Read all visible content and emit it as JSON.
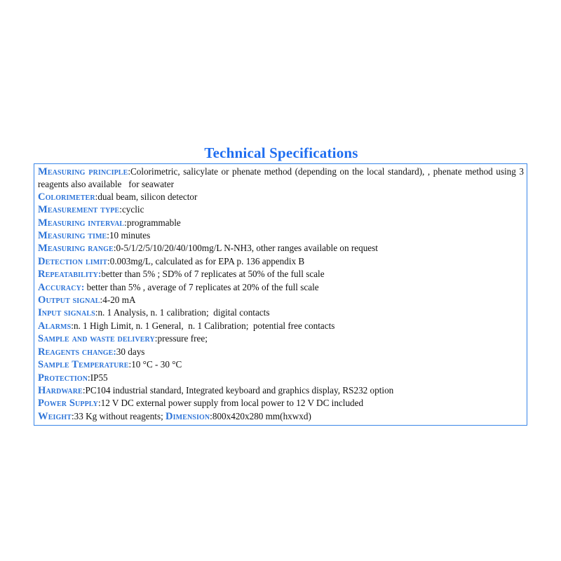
{
  "document": {
    "title": "Technical Specifications",
    "title_color": "#1f6ef0",
    "label_color": "#2d74d8",
    "body_color": "#111111",
    "border_color": "#3a86e8"
  },
  "specs": [
    {
      "label": "Measuring principle",
      "separator": ":",
      "value": "Colorimetric, salicylate or phenate method (depending on the local standard), , phenate method using 3 reagents also available   for seawater",
      "justified": true,
      "colon_colored": false
    },
    {
      "label": "Colorimeter",
      "separator": ":",
      "value": "dual beam, silicon detector",
      "justified": false,
      "colon_colored": false
    },
    {
      "label": "Measurement type",
      "separator": ":",
      "value": "cyclic",
      "justified": false,
      "colon_colored": false
    },
    {
      "label": "Measuring interval",
      "separator": ":",
      "value": "programmable",
      "justified": false,
      "colon_colored": false
    },
    {
      "label": "Measuring time",
      "separator": ":",
      "value": "10 minutes",
      "justified": false,
      "colon_colored": false
    },
    {
      "label": "Measuring range",
      "separator": ":",
      "value": "0-5/1/2/5/10/20/40/100mg/L N-NH3, other ranges available on request",
      "justified": false,
      "colon_colored": false
    },
    {
      "label": "Detection limit",
      "separator": ":",
      "value": "0.003mg/L, calculated as for EPA p. 136 appendix B",
      "justified": false,
      "colon_colored": false
    },
    {
      "label": "Repeatability",
      "separator": ":",
      "value": "better than 5% ; SD% of 7 replicates at 50% of the full scale",
      "justified": false,
      "colon_colored": true
    },
    {
      "label": "Accuracy",
      "separator": ":",
      "value": " better than 5% , average of 7 replicates at 20% of the full scale",
      "justified": false,
      "colon_colored": true
    },
    {
      "label": "Output signal",
      "separator": ":",
      "value": "4-20 mA",
      "justified": false,
      "colon_colored": false
    },
    {
      "label": "Input signals",
      "separator": ":",
      "value": "n. 1 Analysis, n. 1 calibration;  digital contacts",
      "justified": false,
      "colon_colored": false
    },
    {
      "label": "Alarms",
      "separator": ":",
      "value": "n. 1 High Limit, n. 1 General,  n. 1 Calibration;  potential free contacts",
      "justified": false,
      "colon_colored": false
    },
    {
      "label": "Sample and waste delivery",
      "separator": ":",
      "value": "pressure free;",
      "justified": false,
      "colon_colored": false
    },
    {
      "label": "Reagents change",
      "separator": ":",
      "value": "30 days",
      "justified": false,
      "colon_colored": true
    },
    {
      "label": "Sample Temperature",
      "separator": ":",
      "value": "10 °C - 30 °C",
      "justified": false,
      "colon_colored": false
    },
    {
      "label": "Protection",
      "separator": ":",
      "value": "IP55",
      "justified": false,
      "colon_colored": false
    },
    {
      "label": "Hardware",
      "separator": ":",
      "value": "PC104 industrial standard, Integrated keyboard and graphics display, RS232 option",
      "justified": false,
      "colon_colored": false
    },
    {
      "label": "Power Supply",
      "separator": ":",
      "value": "12 V DC external power supply from local power to 12 V DC included",
      "justified": false,
      "colon_colored": false
    },
    {
      "label": "Weight",
      "separator": ":",
      "value": "33 Kg without reagents; ",
      "justified": false,
      "colon_colored": false,
      "label2": "Dimension",
      "separator2": ":",
      "value2": "800x420x280 mm(hxwxd)"
    }
  ]
}
